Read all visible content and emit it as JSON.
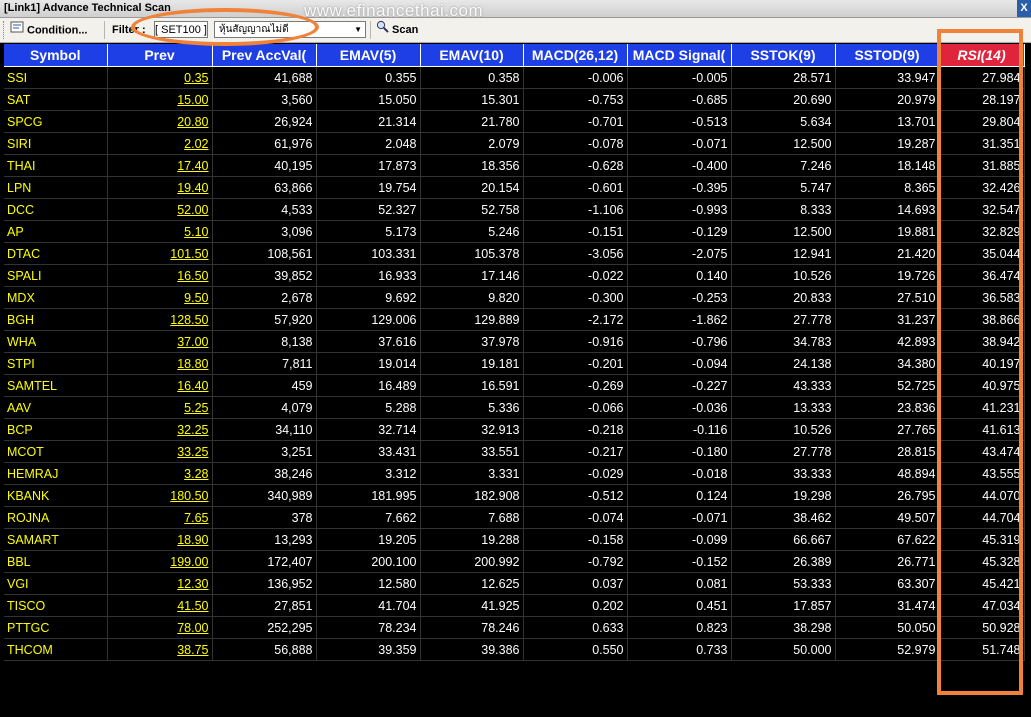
{
  "window": {
    "title": "[Link1] Advance Technical Scan",
    "close_label": "X"
  },
  "watermark": "www.efinancethai.com",
  "toolbar": {
    "condition_label": "Condition...",
    "filter_label": "Filter :",
    "filter_set": "[ SET100 ]",
    "filter_select_value": "หุ้นสัญญาณไม่ดี",
    "scan_label": "Scan"
  },
  "table": {
    "headers": [
      "Symbol",
      "Prev",
      "Prev AccVal(",
      "EMAV(5)",
      "EMAV(10)",
      "MACD(26,12)",
      "MACD Signal(",
      "SSTOK(9)",
      "SSTOD(9)",
      "RSI(14)"
    ],
    "rows": [
      [
        "SSI",
        "0.35",
        "41,688",
        "0.355",
        "0.358",
        "-0.006",
        "-0.005",
        "28.571",
        "33.947",
        "27.984"
      ],
      [
        "SAT",
        "15.00",
        "3,560",
        "15.050",
        "15.301",
        "-0.753",
        "-0.685",
        "20.690",
        "20.979",
        "28.197"
      ],
      [
        "SPCG",
        "20.80",
        "26,924",
        "21.314",
        "21.780",
        "-0.701",
        "-0.513",
        "5.634",
        "13.701",
        "29.804"
      ],
      [
        "SIRI",
        "2.02",
        "61,976",
        "2.048",
        "2.079",
        "-0.078",
        "-0.071",
        "12.500",
        "19.287",
        "31.351"
      ],
      [
        "THAI",
        "17.40",
        "40,195",
        "17.873",
        "18.356",
        "-0.628",
        "-0.400",
        "7.246",
        "18.148",
        "31.885"
      ],
      [
        "LPN",
        "19.40",
        "63,866",
        "19.754",
        "20.154",
        "-0.601",
        "-0.395",
        "5.747",
        "8.365",
        "32.426"
      ],
      [
        "DCC",
        "52.00",
        "4,533",
        "52.327",
        "52.758",
        "-1.106",
        "-0.993",
        "8.333",
        "14.693",
        "32.547"
      ],
      [
        "AP",
        "5.10",
        "3,096",
        "5.173",
        "5.246",
        "-0.151",
        "-0.129",
        "12.500",
        "19.881",
        "32.829"
      ],
      [
        "DTAC",
        "101.50",
        "108,561",
        "103.331",
        "105.378",
        "-3.056",
        "-2.075",
        "12.941",
        "21.420",
        "35.044"
      ],
      [
        "SPALI",
        "16.50",
        "39,852",
        "16.933",
        "17.146",
        "-0.022",
        "0.140",
        "10.526",
        "19.726",
        "36.474"
      ],
      [
        "MDX",
        "9.50",
        "2,678",
        "9.692",
        "9.820",
        "-0.300",
        "-0.253",
        "20.833",
        "27.510",
        "36.583"
      ],
      [
        "BGH",
        "128.50",
        "57,920",
        "129.006",
        "129.889",
        "-2.172",
        "-1.862",
        "27.778",
        "31.237",
        "38.866"
      ],
      [
        "WHA",
        "37.00",
        "8,138",
        "37.616",
        "37.978",
        "-0.916",
        "-0.796",
        "34.783",
        "42.893",
        "38.942"
      ],
      [
        "STPI",
        "18.80",
        "7,811",
        "19.014",
        "19.181",
        "-0.201",
        "-0.094",
        "24.138",
        "34.380",
        "40.197"
      ],
      [
        "SAMTEL",
        "16.40",
        "459",
        "16.489",
        "16.591",
        "-0.269",
        "-0.227",
        "43.333",
        "52.725",
        "40.975"
      ],
      [
        "AAV",
        "5.25",
        "4,079",
        "5.288",
        "5.336",
        "-0.066",
        "-0.036",
        "13.333",
        "23.836",
        "41.231"
      ],
      [
        "BCP",
        "32.25",
        "34,110",
        "32.714",
        "32.913",
        "-0.218",
        "-0.116",
        "10.526",
        "27.765",
        "41.613"
      ],
      [
        "MCOT",
        "33.25",
        "3,251",
        "33.431",
        "33.551",
        "-0.217",
        "-0.180",
        "27.778",
        "28.815",
        "43.474"
      ],
      [
        "HEMRAJ",
        "3.28",
        "38,246",
        "3.312",
        "3.331",
        "-0.029",
        "-0.018",
        "33.333",
        "48.894",
        "43.555"
      ],
      [
        "KBANK",
        "180.50",
        "340,989",
        "181.995",
        "182.908",
        "-0.512",
        "0.124",
        "19.298",
        "26.795",
        "44.070"
      ],
      [
        "ROJNA",
        "7.65",
        "378",
        "7.662",
        "7.688",
        "-0.074",
        "-0.071",
        "38.462",
        "49.507",
        "44.704"
      ],
      [
        "SAMART",
        "18.90",
        "13,293",
        "19.205",
        "19.288",
        "-0.158",
        "-0.099",
        "66.667",
        "67.622",
        "45.319"
      ],
      [
        "BBL",
        "199.00",
        "172,407",
        "200.100",
        "200.992",
        "-0.792",
        "-0.152",
        "26.389",
        "26.771",
        "45.328"
      ],
      [
        "VGI",
        "12.30",
        "136,952",
        "12.580",
        "12.625",
        "0.037",
        "0.081",
        "53.333",
        "63.307",
        "45.421"
      ],
      [
        "TISCO",
        "41.50",
        "27,851",
        "41.704",
        "41.925",
        "0.202",
        "0.451",
        "17.857",
        "31.474",
        "47.034"
      ],
      [
        "PTTGC",
        "78.00",
        "252,295",
        "78.234",
        "78.246",
        "0.633",
        "0.823",
        "38.298",
        "50.050",
        "50.928"
      ],
      [
        "THCOM",
        "38.75",
        "56,888",
        "39.359",
        "39.386",
        "0.550",
        "0.733",
        "50.000",
        "52.979",
        "51.748"
      ]
    ]
  },
  "colors": {
    "header_bg": "#1f3fe6",
    "rsi_header_bg": "#e0243c",
    "symbol": "#ffff00",
    "highlight": "#f0823a"
  }
}
